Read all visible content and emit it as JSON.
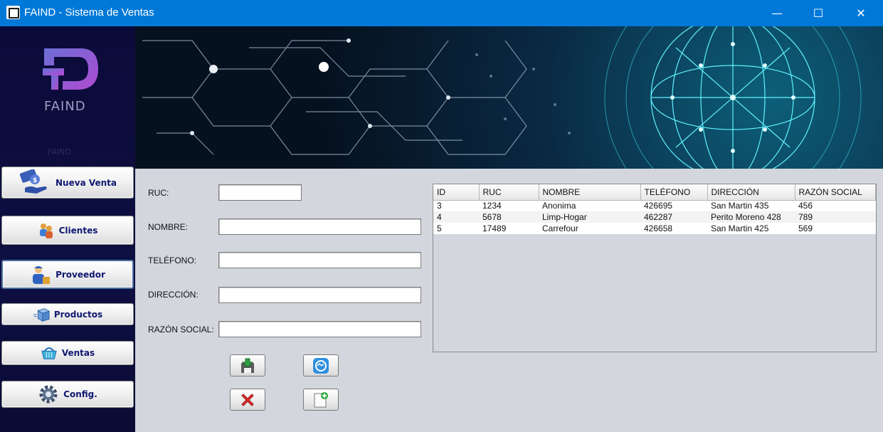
{
  "window": {
    "title": "FAIND - Sistema de Ventas",
    "controls": {
      "minimize": "—",
      "maximize": "☐",
      "close": "✕"
    }
  },
  "sidebar": {
    "logo_text": "FAIND",
    "logo_subtext": "FAIND",
    "items": [
      {
        "label": "Nueva Venta",
        "icon": "money-hand-icon",
        "active": false
      },
      {
        "label": "Clientes",
        "icon": "clients-icon",
        "active": false
      },
      {
        "label": "Proveedor",
        "icon": "supplier-icon",
        "active": true
      },
      {
        "label": "Productos",
        "icon": "box-icon",
        "active": false
      },
      {
        "label": "Ventas",
        "icon": "basket-icon",
        "active": false
      },
      {
        "label": "Config.",
        "icon": "gear-icon",
        "active": false
      }
    ]
  },
  "form": {
    "ruc_label": "RUC:",
    "nombre_label": "NOMBRE:",
    "telefono_label": "TELÉFONO:",
    "direccion_label": "DIRECCIÓN:",
    "razon_label": "RAZÓN SOCIAL:",
    "ruc_value": "",
    "nombre_value": "",
    "telefono_value": "",
    "direccion_value": "",
    "razon_value": "",
    "buttons": {
      "save_icon": "save-download-icon",
      "update_icon": "update-icon",
      "delete_icon": "delete-x-icon",
      "new_icon": "new-document-icon"
    }
  },
  "table": {
    "columns": [
      "ID",
      "RUC",
      "NOMBRE",
      "TELÉFONO",
      "DIRECCIÓN",
      "RAZÓN SOCIAL"
    ],
    "rows": [
      [
        "3",
        "1234",
        "Anonima",
        "426695",
        "San Martin 435",
        "456"
      ],
      [
        "4",
        "5678",
        "Limp-Hogar",
        "462287",
        "Perito Moreno 428",
        "789"
      ],
      [
        "5",
        "17489",
        "Carrefour",
        "426658",
        "San Martin 425",
        "569"
      ]
    ]
  },
  "colors": {
    "titlebar": "#0078d7",
    "sidebar": "#0b0b3a",
    "nav_text": "#101870",
    "background": "#d4d6de"
  }
}
